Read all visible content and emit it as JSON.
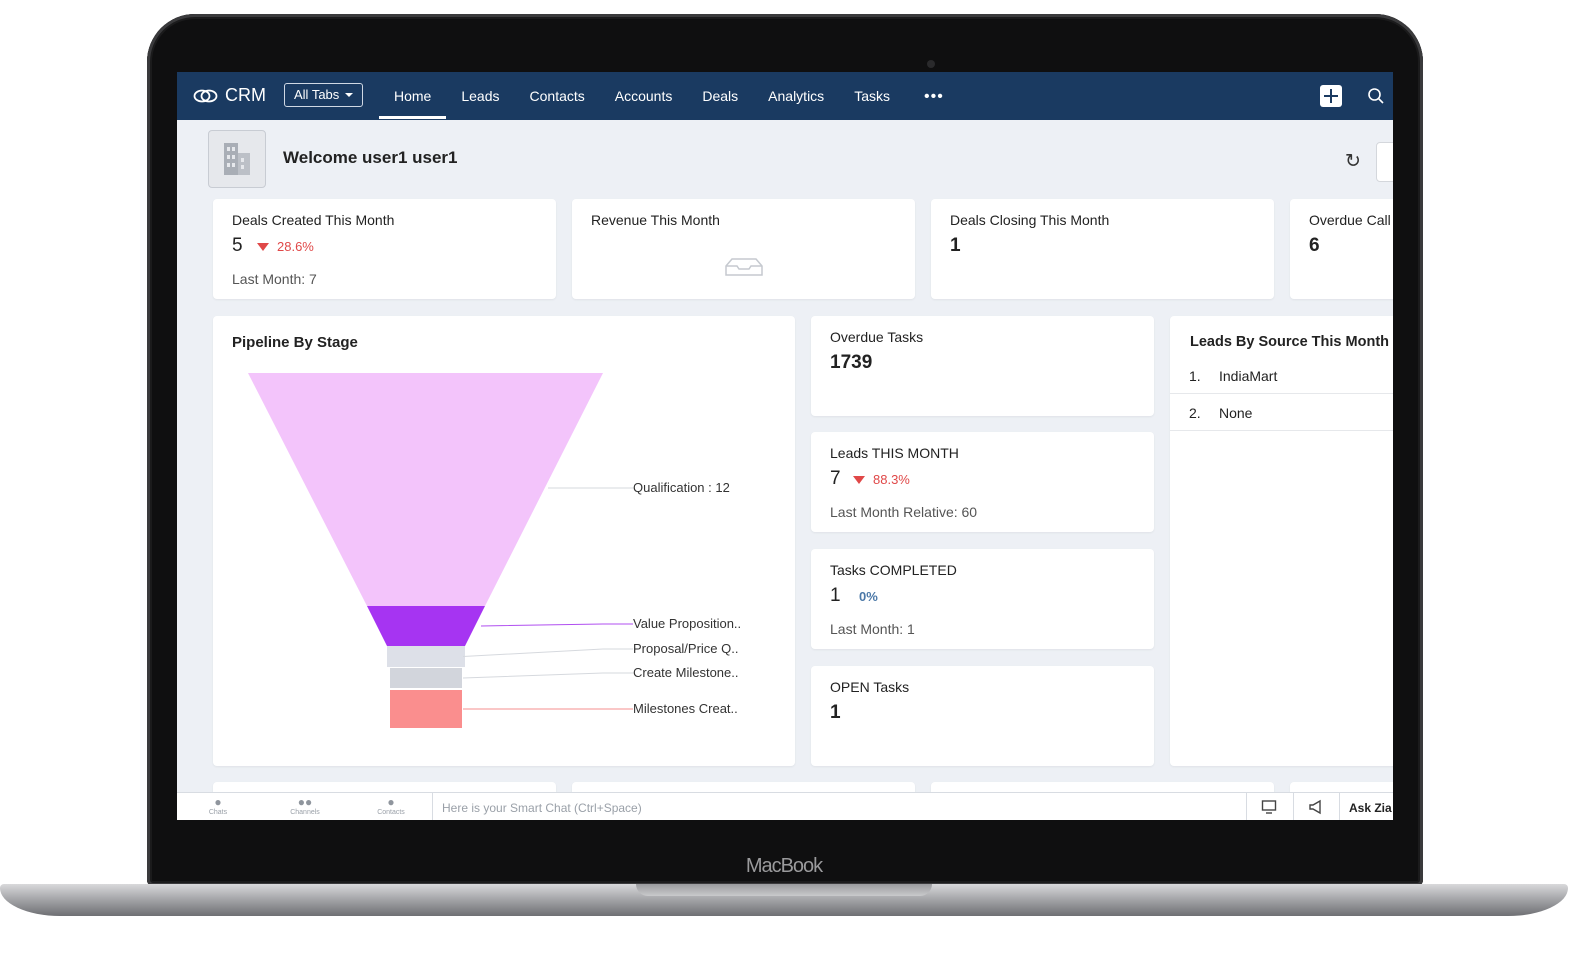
{
  "laptop": {
    "brand": "MacBook"
  },
  "app": {
    "name": "CRM",
    "all_tabs_label": "All Tabs",
    "tabs": [
      "Home",
      "Leads",
      "Contacts",
      "Accounts",
      "Deals",
      "Analytics",
      "Tasks"
    ],
    "active_tab": "Home",
    "more_label": "•••"
  },
  "welcome": {
    "text": "Welcome user1 user1"
  },
  "kpi_cards": {
    "deals_created": {
      "title": "Deals Created This Month",
      "value": "5",
      "delta": "28.6%",
      "sub": "Last Month: 7"
    },
    "revenue": {
      "title": "Revenue This Month"
    },
    "deals_closing": {
      "title": "Deals Closing This Month",
      "value": "1"
    },
    "overdue_calls": {
      "title": "Overdue Call",
      "value": "6"
    }
  },
  "pipeline": {
    "title": "Pipeline By Stage",
    "chart_data": {
      "type": "funnel",
      "categories": [
        "Qualification",
        "Value Proposition..",
        "Proposal/Price Q..",
        "Create Milestone..",
        "Milestones Creat.."
      ],
      "values": [
        12,
        null,
        null,
        null,
        null
      ],
      "labels": [
        "Qualification : 12",
        "Value Proposition..",
        "Proposal/Price Q..",
        "Create Milestone..",
        "Milestones Creat.."
      ],
      "colors": [
        "#f3c4fb",
        "#a634f2",
        "#dde0e8",
        "#d2d5dc",
        "#fa8e8e"
      ]
    }
  },
  "task_cards": {
    "overdue_tasks": {
      "title": "Overdue Tasks",
      "value": "1739"
    },
    "leads_this_month": {
      "title": "Leads THIS MONTH",
      "value": "7",
      "delta": "88.3%",
      "sub": "Last Month Relative: 60"
    },
    "tasks_completed": {
      "title": "Tasks COMPLETED",
      "value": "1",
      "delta": "0%",
      "sub": "Last Month: 1"
    },
    "open_tasks": {
      "title": "OPEN Tasks",
      "value": "1"
    }
  },
  "leads_by_source": {
    "title": "Leads By Source This Month",
    "items": [
      {
        "rank": "1.",
        "name": "IndiaMart"
      },
      {
        "rank": "2.",
        "name": "None"
      }
    ]
  },
  "bottom_bar": {
    "chats": "Chats",
    "channels": "Channels",
    "contacts": "Contacts",
    "smart_chat_placeholder": "Here is your Smart Chat (Ctrl+Space)",
    "ask_zia": "Ask Zia"
  }
}
